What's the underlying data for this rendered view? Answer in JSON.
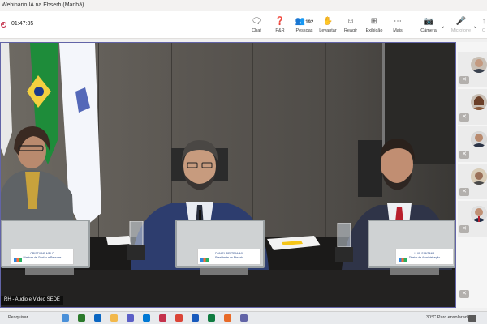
{
  "window": {
    "title": "Webinário IA na Ebserh (Manhã)"
  },
  "meeting": {
    "elapsed": "01:47:35",
    "caption": "RH - Audio e Video SEDE"
  },
  "toolbar": {
    "chat": "Chat",
    "qa": "P&R",
    "people_count": "192",
    "people": "Pessoas",
    "raise": "Levantar",
    "react": "Reagir",
    "view": "Exibição",
    "more": "Mais",
    "camera": "Câmera",
    "mic": "Microfone",
    "share": "C"
  },
  "taskbar": {
    "search": "Pesquisar",
    "weather": "30°C  Parc ensolarado"
  },
  "nameplates": [
    {
      "name": "CRISTIANE MELO",
      "role": "Diretora de Gestão e Pessoas"
    },
    {
      "name": "DANIEL BELTRAMMI",
      "role": "Presidente da Ebserh"
    },
    {
      "name": "LUIS SANTANA",
      "role": "Diretor de Administração"
    }
  ],
  "colors": {
    "accent": "#6264a7",
    "record": "#c4314b"
  }
}
